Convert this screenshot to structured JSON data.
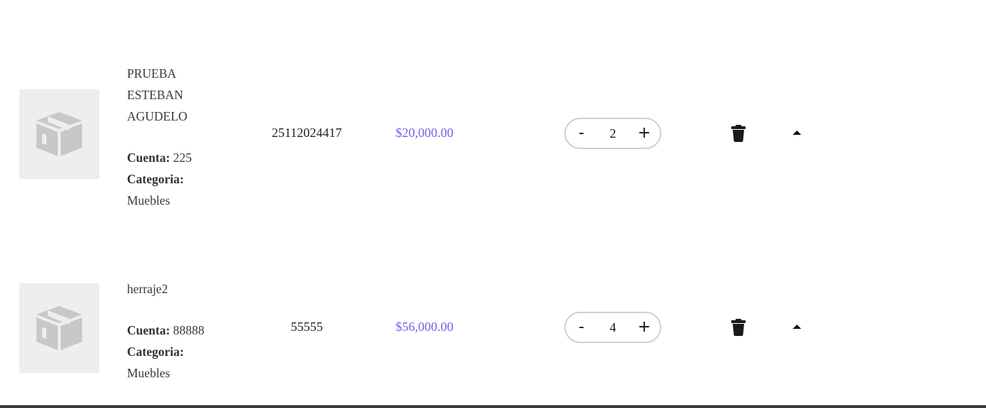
{
  "cart": {
    "items": [
      {
        "name": "PRUEBA ESTEBAN AGUDELO",
        "account_label": "Cuenta:",
        "account_value": "225",
        "category_label": "Categoria:",
        "category_value": "Muebles",
        "code": "25112024417",
        "price": "$20,000.00",
        "decrement_label": "-",
        "quantity": "2",
        "increment_label": "+",
        "image_icon": "box-icon",
        "delete_icon": "trash-icon",
        "toggle_icon": "caret-up-icon"
      },
      {
        "name": "herraje2",
        "account_label": "Cuenta:",
        "account_value": "88888",
        "category_label": "Categoria:",
        "category_value": "Muebles",
        "code": "55555",
        "price": "$56,000.00",
        "decrement_label": "-",
        "quantity": "4",
        "increment_label": "+",
        "image_icon": "box-icon",
        "delete_icon": "trash-icon",
        "toggle_icon": "caret-up-icon"
      }
    ]
  },
  "colors": {
    "price": "#7b5ce6",
    "thumbnail_bg": "#eeeeee",
    "stepper_border": "#cfcfcf",
    "bottom_bar": "#3b3b3b"
  }
}
